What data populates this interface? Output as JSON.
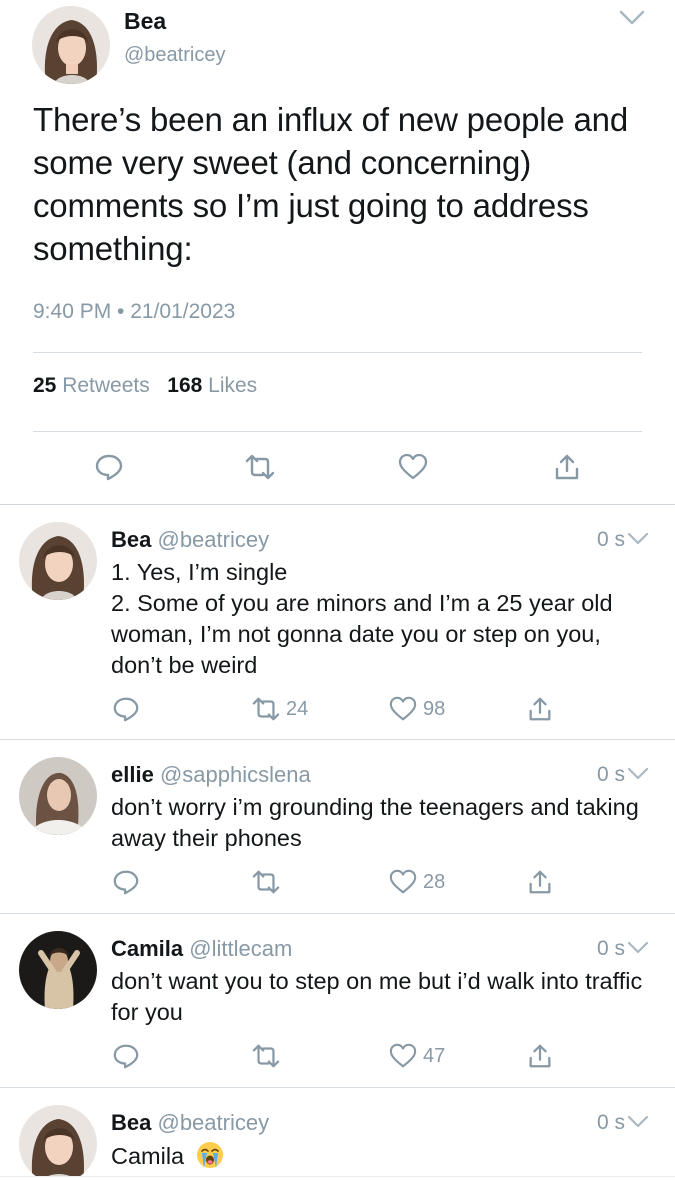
{
  "main_tweet": {
    "name": "Bea",
    "handle": "@beatricey",
    "text": "There’s been an influx of new people and some very sweet (and concerning) comments so I’m just going to address something:",
    "timestamp": "9:40 PM • 21/01/2023",
    "retweets_count": "25",
    "retweets_label": "Retweets",
    "likes_count": "168",
    "likes_label": "Likes"
  },
  "replies": [
    {
      "name": "Bea",
      "handle": "@beatricey",
      "time": "0 s",
      "text_line1": "1. Yes, I’m single",
      "text_line2": "2. Some of you are minors and I’m a 25 year old woman, I’m not gonna date you or step on you, don’t be weird",
      "retweets": "24",
      "likes": "98"
    },
    {
      "name": "ellie",
      "handle": "@sapphicslena",
      "time": "0 s",
      "text": "don’t worry i’m grounding the teenagers and taking away their phones",
      "retweets": "",
      "likes": "28"
    },
    {
      "name": "Camila",
      "handle": "@littlecam",
      "time": "0 s",
      "text": "don’t want you to step on me but i’d walk into traffic for you",
      "retweets": "",
      "likes": "47"
    },
    {
      "name": "Bea",
      "handle": "@beatricey",
      "time": "0 s",
      "text": "Camila",
      "emoji": "crying-face"
    }
  ],
  "colors": {
    "text": "#14171a",
    "secondary": "#8899a6",
    "divider": "#d5dde3"
  }
}
